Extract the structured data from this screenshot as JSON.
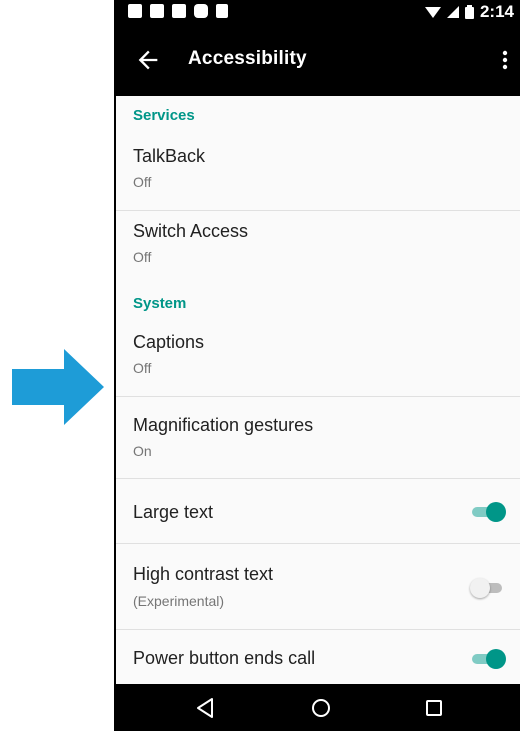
{
  "colors": {
    "accent": "#009688",
    "arrow": "#1e9cd7",
    "bar_background": "#000000"
  },
  "status_bar": {
    "icons": [
      "facebook-icon",
      "facebook-icon",
      "gmail-icon",
      "youtube-icon",
      "flipboard-icon"
    ],
    "time": "2:14"
  },
  "toolbar": {
    "title": "Accessibility"
  },
  "sections": {
    "services": "Services",
    "system": "System"
  },
  "items": {
    "talkback": {
      "title": "TalkBack",
      "summary": "Off"
    },
    "switch_access": {
      "title": "Switch Access",
      "summary": "Off"
    },
    "captions": {
      "title": "Captions",
      "summary": "Off"
    },
    "magnification": {
      "title": "Magnification gestures",
      "summary": "On"
    },
    "large_text": {
      "title": "Large text",
      "enabled": true
    },
    "high_contrast": {
      "title": "High contrast text",
      "summary": "(Experimental)",
      "enabled": false
    },
    "power_button": {
      "title": "Power button ends call",
      "enabled": true
    }
  }
}
